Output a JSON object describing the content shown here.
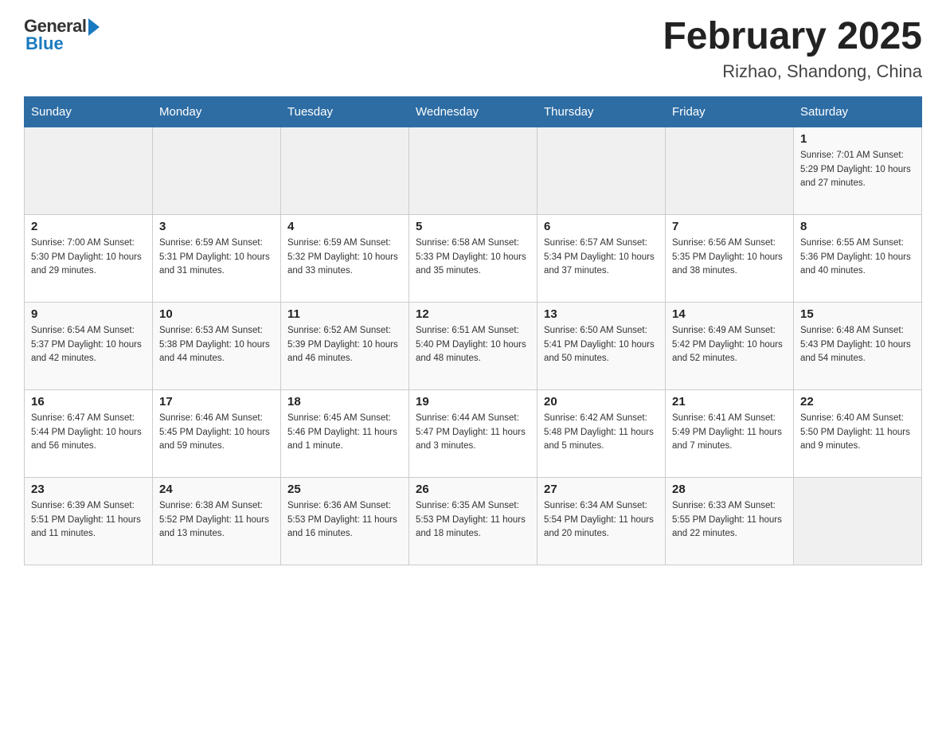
{
  "header": {
    "logo_general": "General",
    "logo_blue": "Blue",
    "month_title": "February 2025",
    "location": "Rizhao, Shandong, China"
  },
  "weekdays": [
    "Sunday",
    "Monday",
    "Tuesday",
    "Wednesday",
    "Thursday",
    "Friday",
    "Saturday"
  ],
  "weeks": [
    [
      {
        "day": "",
        "info": ""
      },
      {
        "day": "",
        "info": ""
      },
      {
        "day": "",
        "info": ""
      },
      {
        "day": "",
        "info": ""
      },
      {
        "day": "",
        "info": ""
      },
      {
        "day": "",
        "info": ""
      },
      {
        "day": "1",
        "info": "Sunrise: 7:01 AM\nSunset: 5:29 PM\nDaylight: 10 hours\nand 27 minutes."
      }
    ],
    [
      {
        "day": "2",
        "info": "Sunrise: 7:00 AM\nSunset: 5:30 PM\nDaylight: 10 hours\nand 29 minutes."
      },
      {
        "day": "3",
        "info": "Sunrise: 6:59 AM\nSunset: 5:31 PM\nDaylight: 10 hours\nand 31 minutes."
      },
      {
        "day": "4",
        "info": "Sunrise: 6:59 AM\nSunset: 5:32 PM\nDaylight: 10 hours\nand 33 minutes."
      },
      {
        "day": "5",
        "info": "Sunrise: 6:58 AM\nSunset: 5:33 PM\nDaylight: 10 hours\nand 35 minutes."
      },
      {
        "day": "6",
        "info": "Sunrise: 6:57 AM\nSunset: 5:34 PM\nDaylight: 10 hours\nand 37 minutes."
      },
      {
        "day": "7",
        "info": "Sunrise: 6:56 AM\nSunset: 5:35 PM\nDaylight: 10 hours\nand 38 minutes."
      },
      {
        "day": "8",
        "info": "Sunrise: 6:55 AM\nSunset: 5:36 PM\nDaylight: 10 hours\nand 40 minutes."
      }
    ],
    [
      {
        "day": "9",
        "info": "Sunrise: 6:54 AM\nSunset: 5:37 PM\nDaylight: 10 hours\nand 42 minutes."
      },
      {
        "day": "10",
        "info": "Sunrise: 6:53 AM\nSunset: 5:38 PM\nDaylight: 10 hours\nand 44 minutes."
      },
      {
        "day": "11",
        "info": "Sunrise: 6:52 AM\nSunset: 5:39 PM\nDaylight: 10 hours\nand 46 minutes."
      },
      {
        "day": "12",
        "info": "Sunrise: 6:51 AM\nSunset: 5:40 PM\nDaylight: 10 hours\nand 48 minutes."
      },
      {
        "day": "13",
        "info": "Sunrise: 6:50 AM\nSunset: 5:41 PM\nDaylight: 10 hours\nand 50 minutes."
      },
      {
        "day": "14",
        "info": "Sunrise: 6:49 AM\nSunset: 5:42 PM\nDaylight: 10 hours\nand 52 minutes."
      },
      {
        "day": "15",
        "info": "Sunrise: 6:48 AM\nSunset: 5:43 PM\nDaylight: 10 hours\nand 54 minutes."
      }
    ],
    [
      {
        "day": "16",
        "info": "Sunrise: 6:47 AM\nSunset: 5:44 PM\nDaylight: 10 hours\nand 56 minutes."
      },
      {
        "day": "17",
        "info": "Sunrise: 6:46 AM\nSunset: 5:45 PM\nDaylight: 10 hours\nand 59 minutes."
      },
      {
        "day": "18",
        "info": "Sunrise: 6:45 AM\nSunset: 5:46 PM\nDaylight: 11 hours\nand 1 minute."
      },
      {
        "day": "19",
        "info": "Sunrise: 6:44 AM\nSunset: 5:47 PM\nDaylight: 11 hours\nand 3 minutes."
      },
      {
        "day": "20",
        "info": "Sunrise: 6:42 AM\nSunset: 5:48 PM\nDaylight: 11 hours\nand 5 minutes."
      },
      {
        "day": "21",
        "info": "Sunrise: 6:41 AM\nSunset: 5:49 PM\nDaylight: 11 hours\nand 7 minutes."
      },
      {
        "day": "22",
        "info": "Sunrise: 6:40 AM\nSunset: 5:50 PM\nDaylight: 11 hours\nand 9 minutes."
      }
    ],
    [
      {
        "day": "23",
        "info": "Sunrise: 6:39 AM\nSunset: 5:51 PM\nDaylight: 11 hours\nand 11 minutes."
      },
      {
        "day": "24",
        "info": "Sunrise: 6:38 AM\nSunset: 5:52 PM\nDaylight: 11 hours\nand 13 minutes."
      },
      {
        "day": "25",
        "info": "Sunrise: 6:36 AM\nSunset: 5:53 PM\nDaylight: 11 hours\nand 16 minutes."
      },
      {
        "day": "26",
        "info": "Sunrise: 6:35 AM\nSunset: 5:53 PM\nDaylight: 11 hours\nand 18 minutes."
      },
      {
        "day": "27",
        "info": "Sunrise: 6:34 AM\nSunset: 5:54 PM\nDaylight: 11 hours\nand 20 minutes."
      },
      {
        "day": "28",
        "info": "Sunrise: 6:33 AM\nSunset: 5:55 PM\nDaylight: 11 hours\nand 22 minutes."
      },
      {
        "day": "",
        "info": ""
      }
    ]
  ]
}
